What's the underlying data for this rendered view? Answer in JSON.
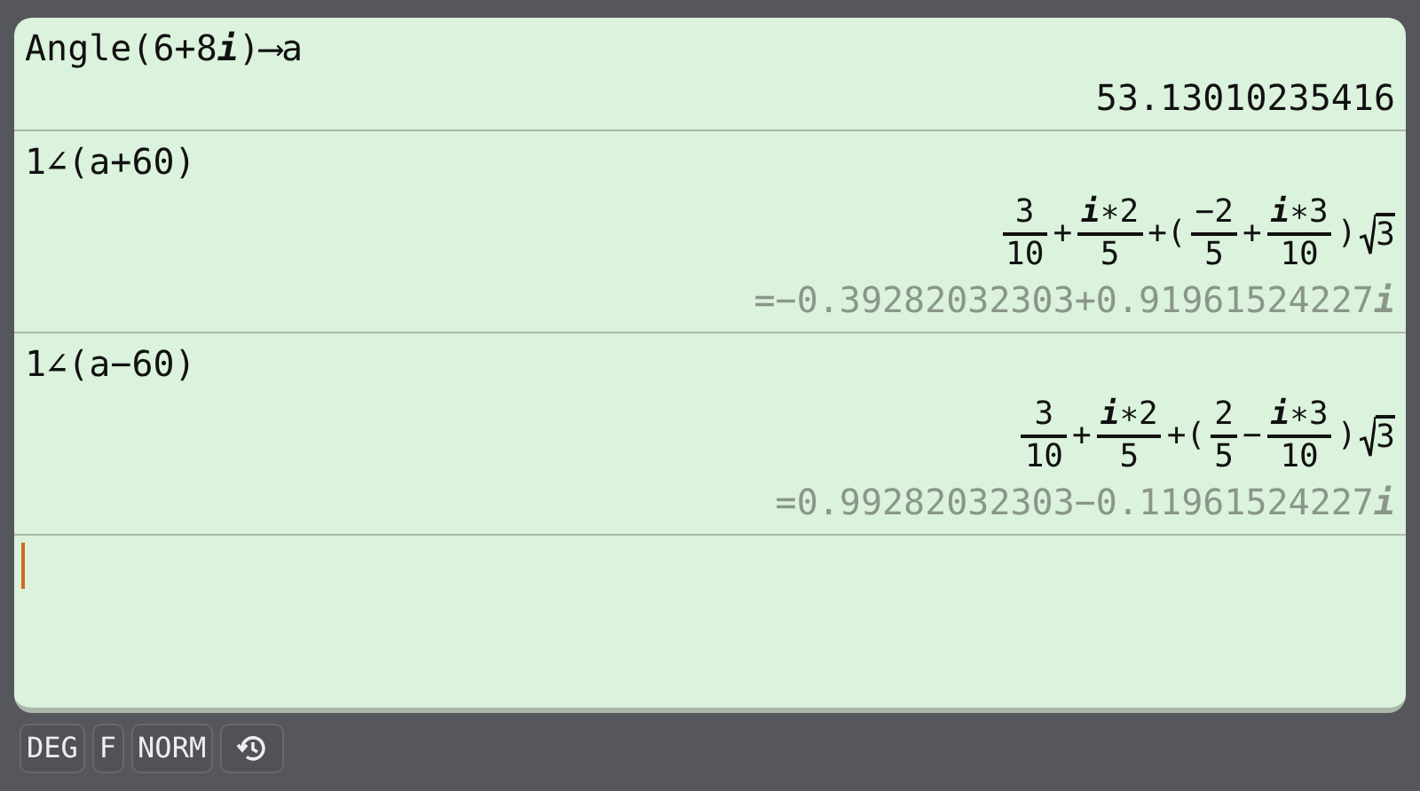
{
  "history": [
    {
      "input": "Angle(6+8**i**)⟶a",
      "results": [
        {
          "kind": "plain",
          "text": "53.13010235416"
        }
      ]
    },
    {
      "input": "1∠(a+60)",
      "results": [
        {
          "kind": "expression",
          "tokens": [
            {
              "kind": "frac",
              "num": "3",
              "den": "10"
            },
            {
              "kind": "op",
              "text": "+"
            },
            {
              "kind": "frac",
              "num": "**i**∗2",
              "den": "5"
            },
            {
              "kind": "op",
              "text": "+("
            },
            {
              "kind": "frac",
              "num": "−2",
              "den": "5"
            },
            {
              "kind": "op",
              "text": "+"
            },
            {
              "kind": "frac",
              "num": "**i**∗3",
              "den": "10"
            },
            {
              "kind": "op",
              "text": ")"
            },
            {
              "kind": "sqrt",
              "text": "3"
            }
          ]
        },
        {
          "kind": "approx",
          "text": "=−0.39282032303+0.91961524227**i**"
        }
      ]
    },
    {
      "input": "1∠(a−60)",
      "results": [
        {
          "kind": "expression",
          "tokens": [
            {
              "kind": "frac",
              "num": "3",
              "den": "10"
            },
            {
              "kind": "op",
              "text": "+"
            },
            {
              "kind": "frac",
              "num": "**i**∗2",
              "den": "5"
            },
            {
              "kind": "op",
              "text": "+("
            },
            {
              "kind": "frac",
              "num": "2",
              "den": "5"
            },
            {
              "kind": "op",
              "text": "−"
            },
            {
              "kind": "frac",
              "num": "**i**∗3",
              "den": "10"
            },
            {
              "kind": "op",
              "text": ")"
            },
            {
              "kind": "sqrt",
              "text": "3"
            }
          ]
        },
        {
          "kind": "approx",
          "text": "=0.99282032303−0.11961524227**i**"
        }
      ]
    }
  ],
  "input_line": {
    "cursor": true
  },
  "status_bar": {
    "buttons": [
      "DEG",
      "F",
      "NORM"
    ],
    "history_button": true
  }
}
